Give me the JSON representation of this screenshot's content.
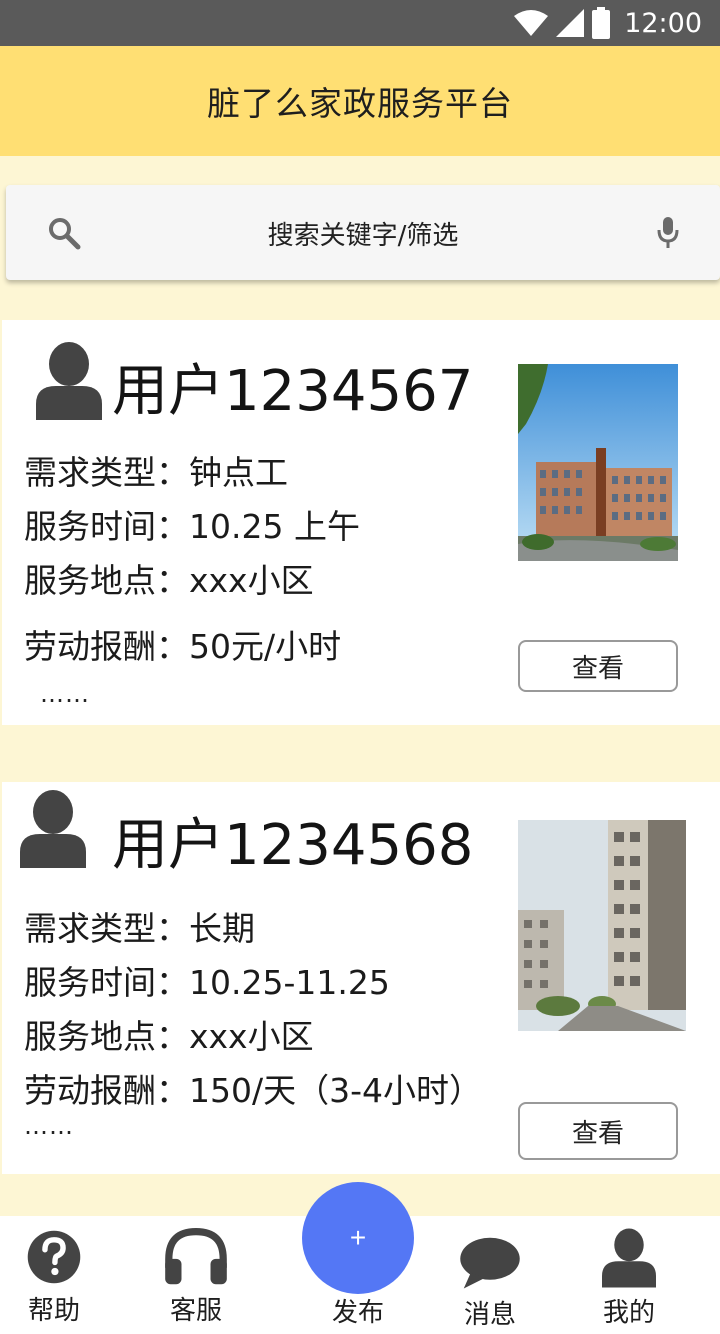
{
  "status_bar": {
    "time": "12:00",
    "icons": [
      "wifi-icon",
      "cellular-signal-icon",
      "battery-icon"
    ]
  },
  "app_bar": {
    "title": "脏了么家政服务平台"
  },
  "search": {
    "placeholder": "搜索关键字/筛选",
    "icons": [
      "search-icon",
      "mic-icon"
    ]
  },
  "listings": [
    {
      "user": "用户1234567",
      "demand_type": "需求类型：钟点工",
      "service_time": "服务时间：10.25 上午",
      "service_location": "服务地点：xxx小区",
      "payment": "劳动报酬：50元/小时",
      "more": "……",
      "view_label": "查看"
    },
    {
      "user": "用户1234568",
      "demand_type": "需求类型：长期",
      "service_time": "服务时间：10.25-11.25",
      "service_location": "服务地点：xxx小区",
      "payment": "劳动报酬：150/天（3-4小时）",
      "more": "……",
      "view_label": "查看"
    }
  ],
  "bottom_nav": {
    "help": "帮助",
    "customer_service": "客服",
    "publish": "发布",
    "publish_symbol": "+",
    "messages": "消息",
    "mine": "我的"
  },
  "colors": {
    "app_bar": "#ffdf73",
    "background": "#fdf6d4",
    "fab": "#5477f5",
    "status_bar": "#5a5a5a"
  }
}
